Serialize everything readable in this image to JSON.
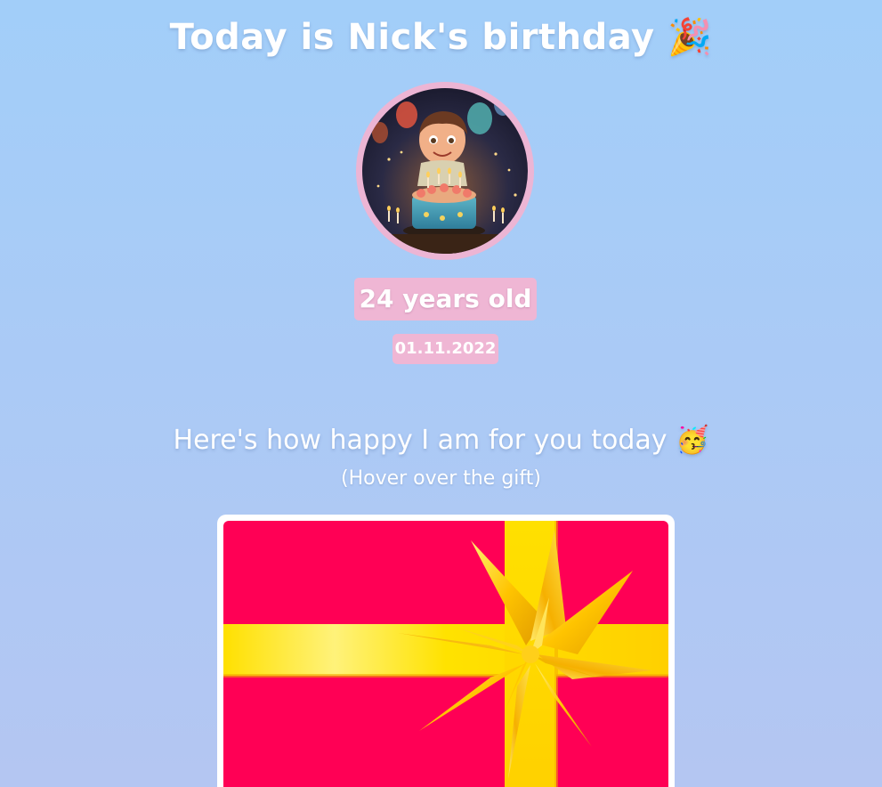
{
  "header": {
    "title": "Today is Nick's birthday",
    "title_emoji": "🎉"
  },
  "profile": {
    "avatar_icon": "birthday-boy-with-cake",
    "age_text": "24 years old",
    "date_text": "01.11.2022"
  },
  "gift_section": {
    "heading": "Here's how happy I am for you today",
    "heading_emoji": "🥳",
    "hint": "(Hover over the gift)",
    "gift_icon": "gift-box-with-bow"
  },
  "colors": {
    "background_top": "#a2cef9",
    "background_bottom": "#b4c6f2",
    "badge_pink": "#efb6d4",
    "gift_red": "#ff0055",
    "ribbon_gold": "#ffd700"
  }
}
